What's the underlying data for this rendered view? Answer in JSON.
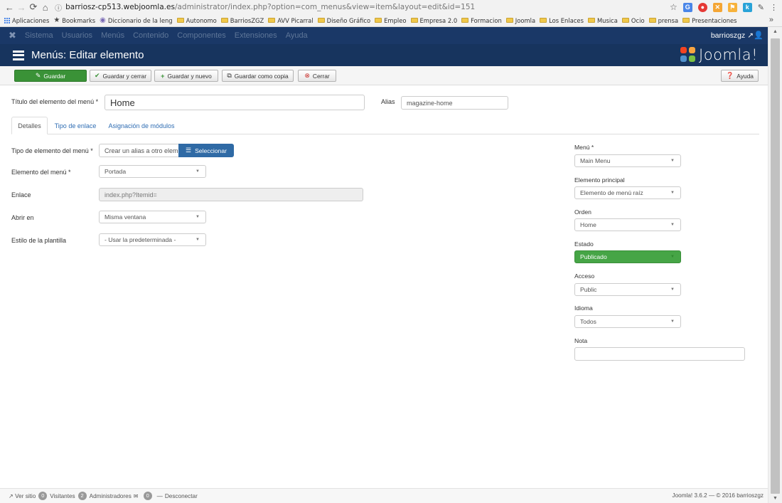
{
  "browser": {
    "url_host": "barriosz-cp513.webjoomla.es",
    "url_path": "/administrator/index.php?option=com_menus&view=item&layout=edit&id=151",
    "bookmarks": [
      "Aplicaciones",
      "Bookmarks",
      "Diccionario de la leng",
      "Autonomo",
      "BarriosZGZ",
      "AVV Picarral",
      "Diseño Gráfico",
      "Empleo",
      "Empresa 2.0",
      "Formacion",
      "Joomla",
      "Los Enlaces",
      "Musica",
      "Ocio",
      "prensa",
      "Presentaciones"
    ],
    "more": "»"
  },
  "admin_nav": {
    "items": [
      "Sistema",
      "Usuarios",
      "Menús",
      "Contenido",
      "Componentes",
      "Extensiones",
      "Ayuda"
    ],
    "user": "barrioszgz"
  },
  "header": {
    "title": "Menús: Editar elemento",
    "brand": "Joomla!"
  },
  "toolbar": {
    "save": "Guardar",
    "save_close": "Guardar y cerrar",
    "save_new": "Guardar y nuevo",
    "save_copy": "Guardar como copia",
    "close": "Cerrar",
    "help": "Ayuda"
  },
  "form": {
    "title_label": "Título del elemento del menú *",
    "title_value": "Home",
    "alias_label": "Alias",
    "alias_value": "magazine-home"
  },
  "tabs": [
    "Detalles",
    "Tipo de enlace",
    "Asignación de módulos"
  ],
  "details": {
    "type_label": "Tipo de elemento del menú *",
    "type_value": "Crear un alias a otro elem",
    "select_button": "Seleccionar",
    "item_label": "Elemento del menú *",
    "item_value": "Portada",
    "link_label": "Enlace",
    "link_value": "index.php?Itemid=",
    "open_label": "Abrir en",
    "open_value": "Misma ventana",
    "style_label": "Estilo de la plantilla",
    "style_value": "- Usar la predeterminada -"
  },
  "sidebar": {
    "menu_label": "Menú *",
    "menu_value": "Main Menu",
    "parent_label": "Elemento principal",
    "parent_value": "Elemento de menú raíz",
    "order_label": "Orden",
    "order_value": "Home",
    "status_label": "Estado",
    "status_value": "Publicado",
    "access_label": "Acceso",
    "access_value": "Public",
    "language_label": "Idioma",
    "language_value": "Todos",
    "note_label": "Nota",
    "note_value": ""
  },
  "footer": {
    "view_site": "Ver sitio",
    "visitors_count": "0",
    "visitors_label": "Visitantes",
    "admins_count": "2",
    "admins_label": "Administradores",
    "messages_count": "0",
    "logout": "Desconectar",
    "version": "Joomla! 3.6.2 — © 2016 barrioszgz"
  },
  "colors": {
    "admin_nav": "#1a3867",
    "title_bar": "#17345e",
    "save_green": "#3a9237",
    "published_green": "#46a546",
    "select_blue": "#2f6aa5"
  }
}
